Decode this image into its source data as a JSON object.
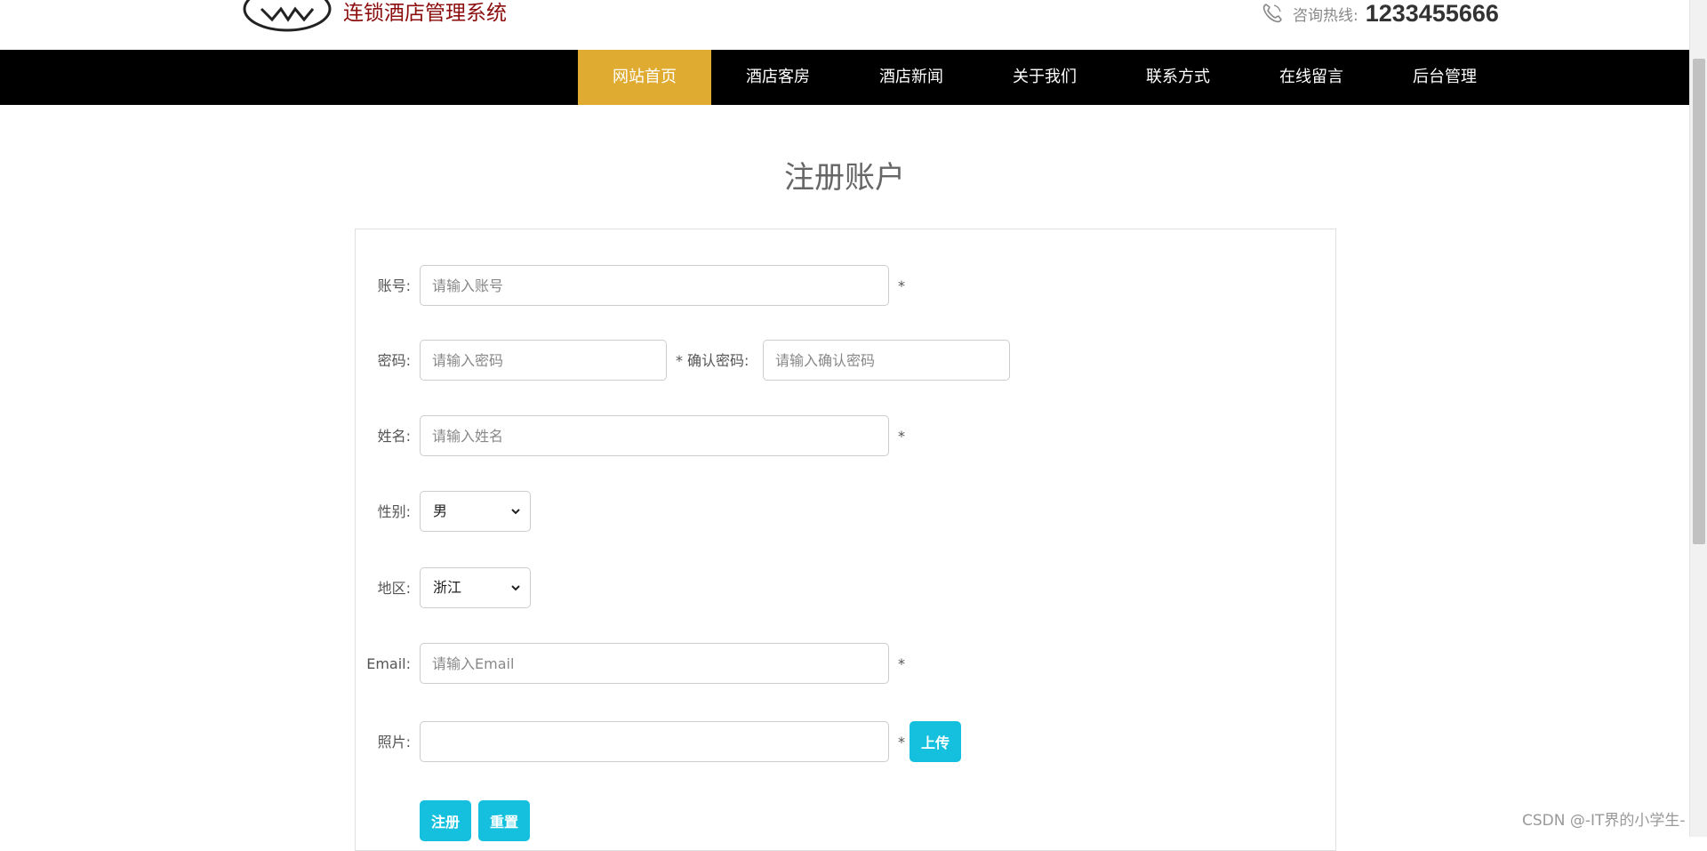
{
  "header": {
    "logo_text": "连锁酒店管理系统",
    "hotline_label": "咨询热线:",
    "hotline_number": "1233455666"
  },
  "nav": {
    "items": [
      {
        "label": "网站首页",
        "active": true
      },
      {
        "label": "酒店客房",
        "active": false
      },
      {
        "label": "酒店新闻",
        "active": false
      },
      {
        "label": "关于我们",
        "active": false
      },
      {
        "label": "联系方式",
        "active": false
      },
      {
        "label": "在线留言",
        "active": false
      },
      {
        "label": "后台管理",
        "active": false
      }
    ]
  },
  "page": {
    "title": "注册账户"
  },
  "form": {
    "account": {
      "label": "账号:",
      "placeholder": "请输入账号",
      "required": "*"
    },
    "password": {
      "label": "密码:",
      "placeholder": "请输入密码",
      "required": "*"
    },
    "confirm_password": {
      "label": "确认密码:",
      "placeholder": "请输入确认密码"
    },
    "name": {
      "label": "姓名:",
      "placeholder": "请输入姓名",
      "required": "*"
    },
    "gender": {
      "label": "性别:",
      "value": "男"
    },
    "region": {
      "label": "地区:",
      "value": "浙江"
    },
    "email": {
      "label": "Email:",
      "placeholder": "请输入Email",
      "required": "*"
    },
    "photo": {
      "label": "照片:",
      "required": "*",
      "upload_label": "上传"
    },
    "register_label": "注册",
    "reset_label": "重置"
  },
  "watermark": "CSDN @-IT界的小学生-",
  "colors": {
    "accent": "#e0ab31",
    "nav_bg": "#000000",
    "button": "#15c0de",
    "logo_text": "#8b0d0d"
  }
}
